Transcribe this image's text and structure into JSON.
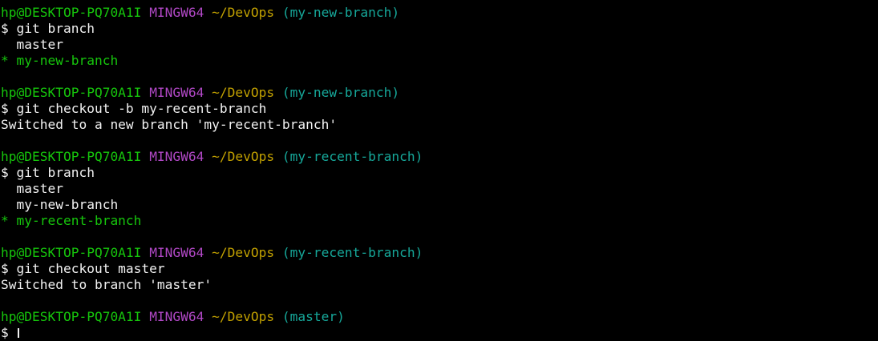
{
  "terminal": {
    "blocks": [
      {
        "prompt": {
          "user": "hp@DESKTOP-PQ70A1I",
          "system": "MINGW64",
          "path": "~/DevOps",
          "branch": "(my-new-branch)"
        },
        "command": "$ git branch",
        "output": [
          {
            "text": "  master",
            "kind": "plain"
          },
          {
            "text": "* my-new-branch",
            "kind": "current"
          }
        ]
      },
      {
        "prompt": {
          "user": "hp@DESKTOP-PQ70A1I",
          "system": "MINGW64",
          "path": "~/DevOps",
          "branch": "(my-new-branch)"
        },
        "command": "$ git checkout -b my-recent-branch",
        "output": [
          {
            "text": "Switched to a new branch 'my-recent-branch'",
            "kind": "plain"
          }
        ]
      },
      {
        "prompt": {
          "user": "hp@DESKTOP-PQ70A1I",
          "system": "MINGW64",
          "path": "~/DevOps",
          "branch": "(my-recent-branch)"
        },
        "command": "$ git branch",
        "output": [
          {
            "text": "  master",
            "kind": "plain"
          },
          {
            "text": "  my-new-branch",
            "kind": "plain"
          },
          {
            "text": "* my-recent-branch",
            "kind": "current"
          }
        ]
      },
      {
        "prompt": {
          "user": "hp@DESKTOP-PQ70A1I",
          "system": "MINGW64",
          "path": "~/DevOps",
          "branch": "(my-recent-branch)"
        },
        "command": "$ git checkout master",
        "output": [
          {
            "text": "Switched to branch 'master'",
            "kind": "plain"
          }
        ]
      }
    ],
    "final_prompt": {
      "user": "hp@DESKTOP-PQ70A1I",
      "system": "MINGW64",
      "path": "~/DevOps",
      "branch": "(master)"
    },
    "input_prefix": "$ ",
    "input_value": "",
    "colors": {
      "background": "#000000",
      "text": "#f2f2f2",
      "user": "#16c60c",
      "system": "#b148c6",
      "path": "#c1a000",
      "branch": "#16a89a",
      "current_branch": "#16c60c"
    }
  }
}
